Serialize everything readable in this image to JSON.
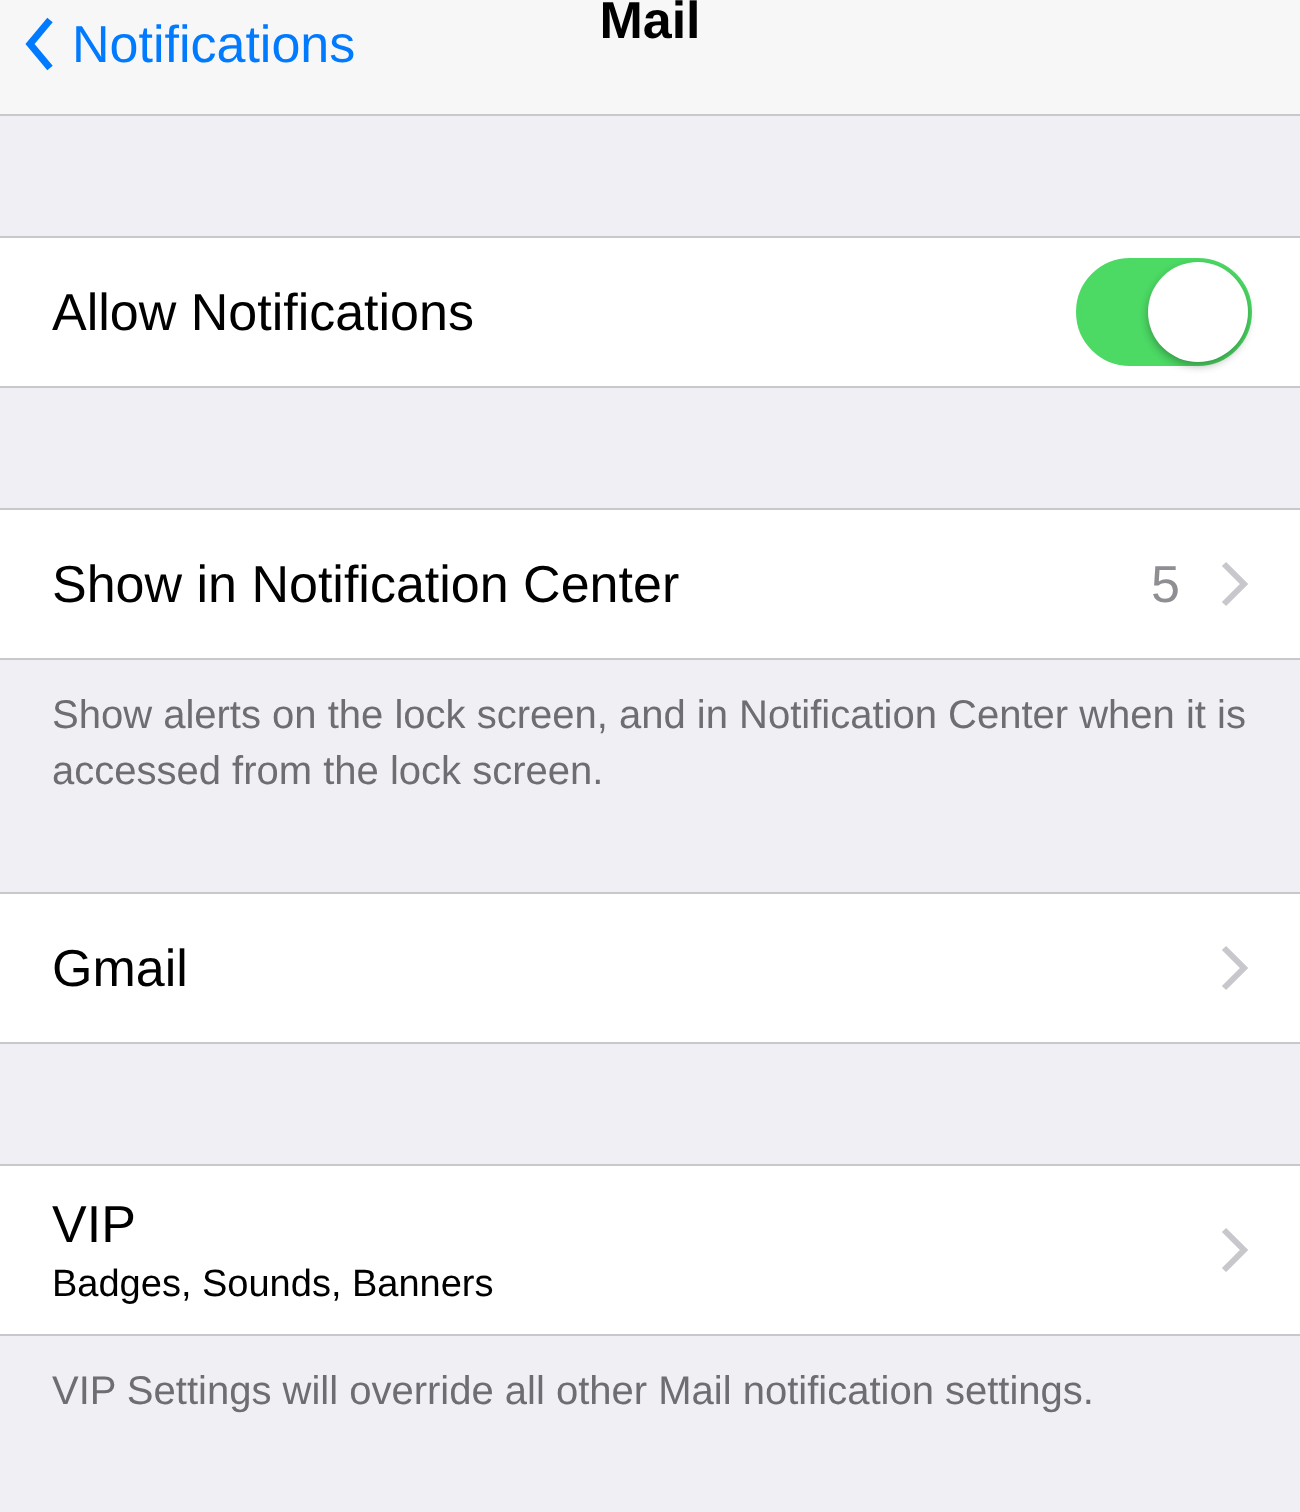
{
  "nav": {
    "back_label": "Notifications",
    "title": "Mail"
  },
  "sections": [
    {
      "rows": [
        {
          "kind": "toggle",
          "label": "Allow Notifications",
          "on": true
        }
      ]
    },
    {
      "rows": [
        {
          "kind": "disclosure",
          "label": "Show in Notification Center",
          "value": "5"
        }
      ],
      "footer": "Show alerts on the lock screen, and in Notification Center when it is accessed from the lock screen."
    },
    {
      "rows": [
        {
          "kind": "disclosure",
          "label": "Gmail"
        }
      ]
    },
    {
      "rows": [
        {
          "kind": "disclosure",
          "label": "VIP",
          "subtitle": "Badges, Sounds, Banners"
        }
      ],
      "footer": "VIP Settings will override all other Mail notification settings."
    }
  ]
}
